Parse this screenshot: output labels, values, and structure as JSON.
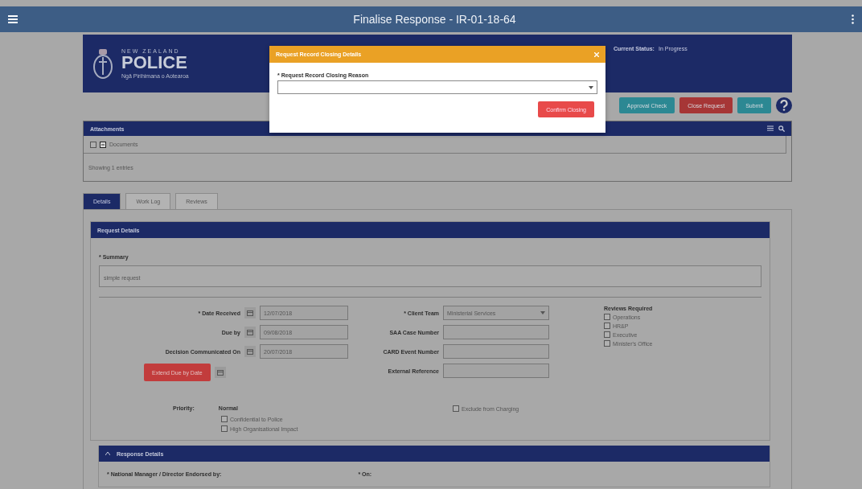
{
  "app_bar": {
    "title": "Finalise Response - IR-01-18-64"
  },
  "header": {
    "logo_top": "NEW ZEALAND",
    "logo_main": "POLICE",
    "logo_sub": "Ngā Pirihimana o Aotearoa",
    "status_label": "Current Status:",
    "status_value": "In Progress"
  },
  "actions": [
    {
      "label": "Approval Check",
      "kind": "teal"
    },
    {
      "label": "Close Request",
      "kind": "danger"
    },
    {
      "label": "Submit",
      "kind": "teal"
    }
  ],
  "attachments": {
    "title": "Attachments",
    "items": [
      {
        "label": "Documents",
        "checked": false
      }
    ],
    "footer": "Showing 1 entries"
  },
  "tabs": [
    {
      "label": "Details",
      "selected": true
    },
    {
      "label": "Work Log",
      "selected": false
    },
    {
      "label": "Reviews",
      "selected": false
    }
  ],
  "request_details": {
    "title": "Request Details",
    "summary_label": "* Summary",
    "summary_value": "simple request",
    "left_fields": [
      {
        "label": "* Date Received",
        "value": "12/07/2018"
      },
      {
        "label": "Due by",
        "value": "09/08/2018"
      },
      {
        "label": "Decision Communicated On",
        "value": "20/07/2018"
      }
    ],
    "extend_button": "Extend Due by Date",
    "client_team": {
      "label": "* Client Team",
      "value": "Ministerial Services"
    },
    "mid_fields": [
      {
        "label": "SAA Case Number"
      },
      {
        "label": "CARD Event Number"
      },
      {
        "label": "External Reference"
      }
    ],
    "reviews_title": "Reviews Required",
    "reviews": [
      {
        "label": "Operations",
        "checked": false
      },
      {
        "label": "HR&P",
        "checked": false
      },
      {
        "label": "Executive",
        "checked": false
      },
      {
        "label": "Minister's Office",
        "checked": false
      }
    ],
    "priority_label": "Priority:",
    "priority_value": "Normal",
    "flags": [
      {
        "label": "Confidential to Police",
        "checked": false
      },
      {
        "label": "High Organisational Impact",
        "checked": false
      }
    ],
    "exclude": {
      "label": "Exclude from Charging",
      "checked": false
    }
  },
  "response_details": {
    "title": "Response Details",
    "endorsed_label": "* National Manager / Director Endorsed by:",
    "on_label": "* On:"
  },
  "dialog": {
    "title": "Request Record Closing Details",
    "field_label": "* Request Record Closing Reason",
    "confirm": "Confirm Closing"
  }
}
